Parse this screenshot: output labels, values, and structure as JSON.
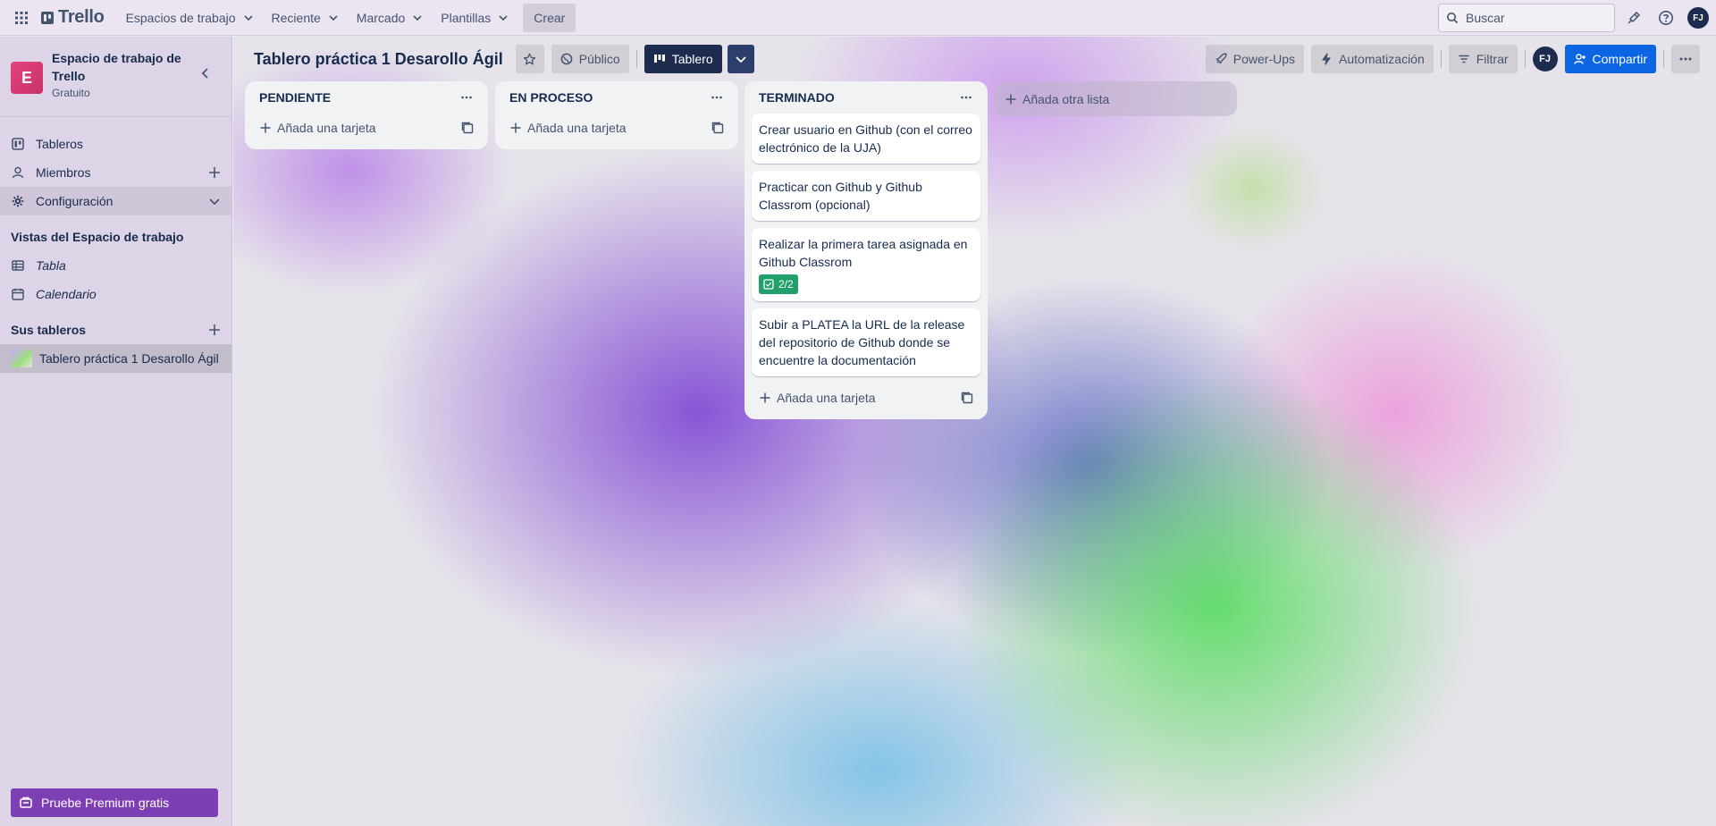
{
  "topbar": {
    "logo": "Trello",
    "menus": [
      {
        "label": "Espacios de trabajo"
      },
      {
        "label": "Reciente"
      },
      {
        "label": "Marcado"
      },
      {
        "label": "Plantillas"
      }
    ],
    "create_label": "Crear",
    "search_placeholder": "Buscar",
    "avatar_initials": "FJ"
  },
  "sidebar": {
    "workspace_initial": "E",
    "workspace_name": "Espacio de trabajo de Trello",
    "workspace_plan": "Gratuito",
    "items": [
      {
        "label": "Tableros",
        "icon": "boards-icon"
      },
      {
        "label": "Miembros",
        "icon": "person-icon"
      },
      {
        "label": "Configuración",
        "icon": "gear-icon"
      }
    ],
    "views_heading": "Vistas del Espacio de trabajo",
    "views": [
      {
        "label": "Tabla",
        "icon": "table-icon"
      },
      {
        "label": "Calendario",
        "icon": "calendar-icon"
      }
    ],
    "boards_heading": "Sus tableros",
    "boards": [
      {
        "label": "Tablero práctica 1 Desarollo Ágil"
      }
    ],
    "premium_label": "Pruebe Premium gratis"
  },
  "board": {
    "title": "Tablero práctica 1 Desarollo Ágil",
    "visibility": "Público",
    "view": "Tablero",
    "powerups": "Power-Ups",
    "automation": "Automatización",
    "filter": "Filtrar",
    "member_initials": "FJ",
    "share": "Compartir",
    "add_list": "Añada otra lista"
  },
  "lists": [
    {
      "title": "PENDIENTE",
      "add_card": "Añada una tarjeta",
      "cards": []
    },
    {
      "title": "EN PROCESO",
      "add_card": "Añada una tarjeta",
      "cards": []
    },
    {
      "title": "TERMINADO",
      "add_card": "Añada una tarjeta",
      "cards": [
        {
          "text": "Crear usuario en Github (con el correo electrónico de la UJA)"
        },
        {
          "text": "Practicar con Github y Github Classrom (opcional)"
        },
        {
          "text": "Realizar la primera tarea asignada en Github Classrom",
          "checklist": "2/2"
        },
        {
          "text": "Subir a PLATEA la URL de la release del repositorio de Github donde se encuentre la documentación"
        }
      ]
    }
  ],
  "colors": {
    "accent": "#0c66e4",
    "premium": "#7e3fb5",
    "badge": "#22a06b",
    "workspace": "#e2437f"
  }
}
